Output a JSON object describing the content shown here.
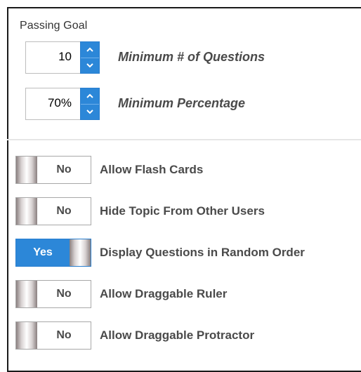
{
  "passing_goal": {
    "title": "Passing Goal",
    "min_questions": {
      "value": "10",
      "label": "Minimum # of Questions"
    },
    "min_percentage": {
      "value": "70%",
      "label": "Minimum Percentage"
    }
  },
  "toggles": [
    {
      "state": "No",
      "label": "Allow Flash Cards",
      "on": false
    },
    {
      "state": "No",
      "label": "Hide Topic From Other Users",
      "on": false
    },
    {
      "state": "Yes",
      "label": "Display Questions in Random Order",
      "on": true
    },
    {
      "state": "No",
      "label": "Allow Draggable Ruler",
      "on": false
    },
    {
      "state": "No",
      "label": "Allow Draggable Protractor",
      "on": false
    }
  ],
  "colors": {
    "accent": "#2c87d8",
    "label_text": "#4a4a4a",
    "border": "#1a1a1a"
  },
  "icons": [
    "chevron-up-icon",
    "chevron-down-icon"
  ]
}
